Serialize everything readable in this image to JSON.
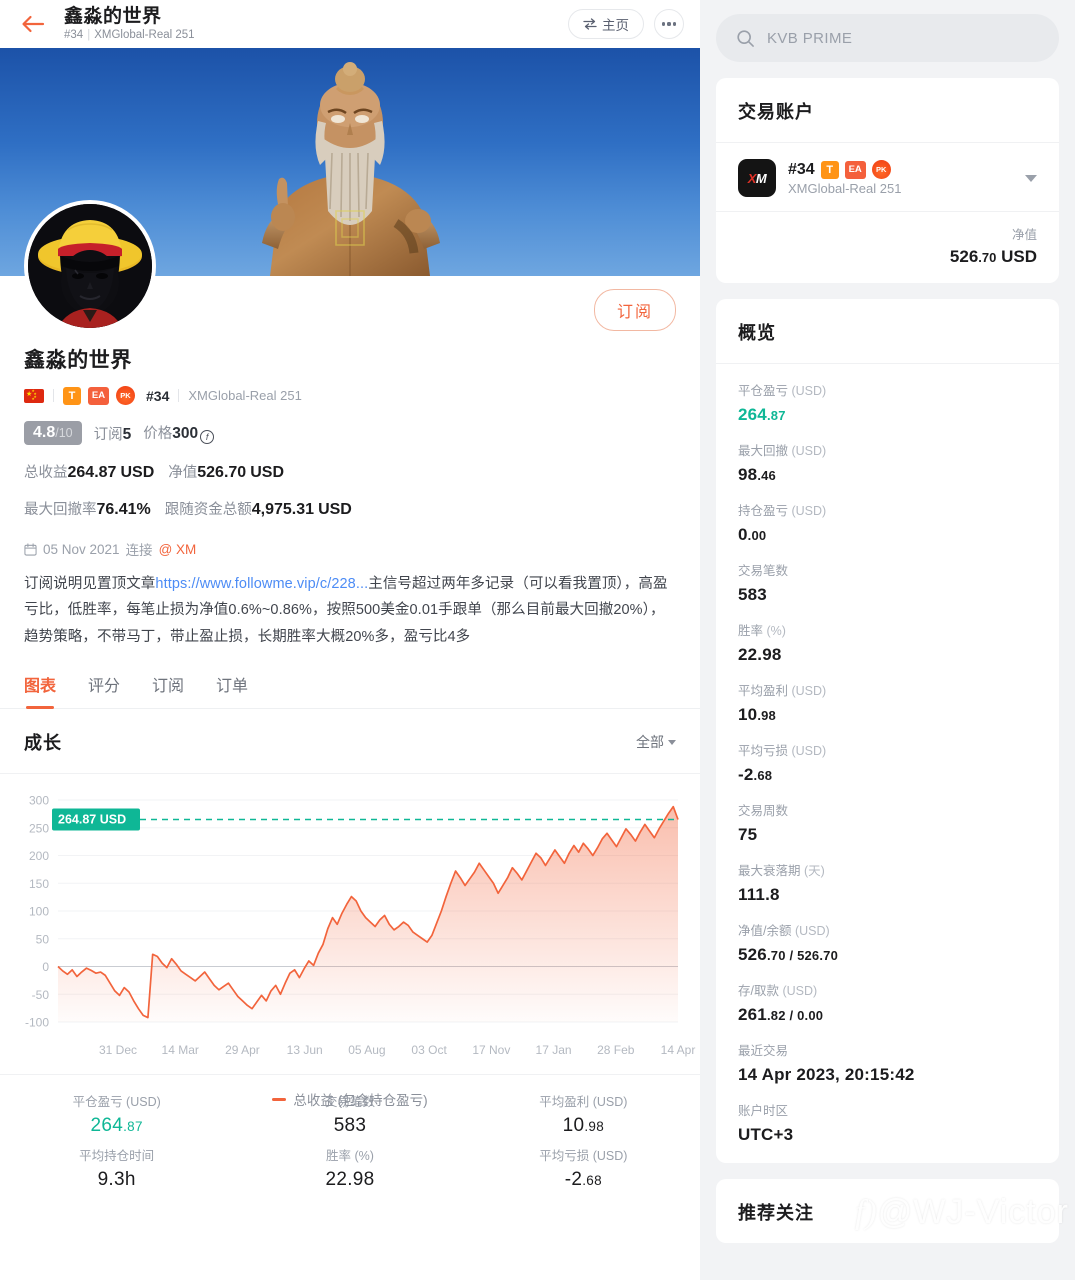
{
  "topbar": {
    "title": "鑫淼的世界",
    "account_id": "#34",
    "separator": "|",
    "server": "XMGlobal-Real 251",
    "home_label": "主页",
    "back_icon": "back-arrow-icon",
    "more_icon": "more-dots-icon"
  },
  "profile": {
    "name": "鑫淼的世界",
    "subscribe_label": "订阅",
    "badges": {
      "flag": "cn-flag-icon",
      "t": "T",
      "ea": "EA",
      "pk": "PK"
    },
    "account_id": "#34",
    "server": "XMGlobal-Real 251",
    "score": "4.8",
    "score_denominator": "/10",
    "subs_label": "订阅",
    "subs_value": "5",
    "price_label": "价格",
    "price_value": "300",
    "total_return_label": "总收益",
    "total_return_value": "264.87",
    "total_return_unit": "USD",
    "equity_label": "净值",
    "equity_value": "526.70",
    "equity_unit": "USD",
    "max_dd_label": "最大回撤率",
    "max_dd_value": "76.41%",
    "follow_funds_label": "跟随资金总额",
    "follow_funds_value": "4,975.31",
    "follow_funds_unit": "USD",
    "connect_date": "05 Nov 2021",
    "connect_label": "连接",
    "broker_handle": "@ XM",
    "description_pre": "订阅说明见置顶文章",
    "description_link": "https://www.followme.vip/c/228...",
    "description_post": "主信号超过两年多记录（可以看我置顶），高盈亏比，低胜率，每笔止损为净值0.6%~0.86%，按照500美金0.01手跟单（那么目前最大回撤20%），趋势策略，不带马丁，带止盈止损，长期胜率大概20%多，盈亏比4多"
  },
  "tabs": [
    {
      "label": "图表",
      "active": true
    },
    {
      "label": "评分",
      "active": false
    },
    {
      "label": "订阅",
      "active": false
    },
    {
      "label": "订单",
      "active": false
    }
  ],
  "chart_section": {
    "title": "成长",
    "filter_label": "全部"
  },
  "chart_data": {
    "type": "area",
    "title": "成长",
    "xlabel": "",
    "ylabel": "",
    "ylim": [
      -100,
      300
    ],
    "yticks": [
      300,
      250,
      200,
      150,
      100,
      50,
      0,
      -50,
      -100
    ],
    "xticks": [
      "31 Dec",
      "14 Mar",
      "29 Apr",
      "13 Jun",
      "05 Aug",
      "03 Oct",
      "17 Nov",
      "17 Jan",
      "28 Feb",
      "14 Apr"
    ],
    "grid": true,
    "legend": "总收益 (包含持仓盈亏)",
    "legend_position": "bottom",
    "line_color": "#f2643c",
    "marker_label": "264.87 USD",
    "marker_value": 264.87,
    "marker_color": "#0fb796",
    "series": [
      {
        "name": "总收益 (包含持仓盈亏)",
        "values": [
          0,
          -8,
          -14,
          -6,
          -18,
          -10,
          -3,
          -7,
          -12,
          -10,
          -16,
          -30,
          -44,
          -52,
          -38,
          -46,
          -62,
          -76,
          -88,
          -92,
          22,
          18,
          6,
          -2,
          14,
          4,
          -8,
          -14,
          -20,
          -26,
          -18,
          -10,
          -22,
          -34,
          -42,
          -36,
          -30,
          -42,
          -54,
          -62,
          -70,
          -76,
          -64,
          -52,
          -62,
          -44,
          -34,
          -50,
          -30,
          -12,
          -6,
          -20,
          -4,
          10,
          2,
          24,
          40,
          68,
          88,
          76,
          96,
          112,
          126,
          118,
          100,
          88,
          80,
          72,
          84,
          92,
          76,
          66,
          72,
          80,
          74,
          62,
          56,
          50,
          44,
          56,
          78,
          100,
          126,
          150,
          172,
          160,
          146,
          158,
          170,
          186,
          174,
          162,
          150,
          132,
          146,
          160,
          178,
          168,
          156,
          172,
          188,
          204,
          196,
          182,
          196,
          210,
          198,
          186,
          204,
          218,
          206,
          222,
          212,
          200,
          214,
          230,
          240,
          228,
          216,
          232,
          248,
          238,
          226,
          242,
          256,
          244,
          232,
          248,
          262,
          276,
          288,
          264.87
        ]
      }
    ]
  },
  "bottom_stats": [
    {
      "label": "平仓盈亏 (USD)",
      "value": "264",
      "dec": ".87",
      "green": true
    },
    {
      "label": "交易笔数",
      "value": "583",
      "dec": "",
      "green": false
    },
    {
      "label": "平均盈利 (USD)",
      "value": "10",
      "dec": ".98",
      "green": false
    },
    {
      "label": "平均持仓时间",
      "value": "9.3h",
      "dec": "",
      "green": false
    },
    {
      "label": "胜率 (%)",
      "value": "22.98",
      "dec": "",
      "green": false
    },
    {
      "label": "平均亏损 (USD)",
      "value": "-2",
      "dec": ".68",
      "green": false
    }
  ],
  "sidebar": {
    "search_placeholder": "KVB PRIME",
    "search_icon": "search-icon",
    "account_card": {
      "title": "交易账户",
      "broker_logo": "XM",
      "account_id": "#34",
      "badges": {
        "t": "T",
        "ea": "EA",
        "pk": "PK"
      },
      "server": "XMGlobal-Real 251",
      "equity_label": "净值",
      "equity_value": "526",
      "equity_dec": ".70",
      "equity_unit": "USD"
    },
    "overview": {
      "title": "概览",
      "items": [
        {
          "label": "平仓盈亏",
          "unit": "(USD)",
          "value": "264",
          "dec": ".87",
          "green": true
        },
        {
          "label": "最大回撤",
          "unit": "(USD)",
          "value": "98",
          "dec": ".46",
          "green": false
        },
        {
          "label": "持仓盈亏",
          "unit": "(USD)",
          "value": "0",
          "dec": ".00",
          "green": false
        },
        {
          "label": "交易笔数",
          "unit": "",
          "value": "583",
          "dec": "",
          "green": false
        },
        {
          "label": "胜率",
          "unit": "(%)",
          "value": "22.98",
          "dec": "",
          "green": false
        },
        {
          "label": "平均盈利",
          "unit": "(USD)",
          "value": "10",
          "dec": ".98",
          "green": false
        },
        {
          "label": "平均亏损",
          "unit": "(USD)",
          "value": "-2",
          "dec": ".68",
          "green": false
        },
        {
          "label": "交易周数",
          "unit": "",
          "value": "75",
          "dec": "",
          "green": false
        },
        {
          "label": "最大衰落期",
          "unit": "(天)",
          "value": "111.8",
          "dec": "",
          "green": false
        },
        {
          "label": "净值/余额",
          "unit": "(USD)",
          "value": "526",
          "dec": ".70 / 526.70",
          "green": false
        },
        {
          "label": "存/取款",
          "unit": "(USD)",
          "value": "261",
          "dec": ".82 / 0.00",
          "green": false
        },
        {
          "label": "最近交易",
          "unit": "",
          "value": "14 Apr 2023, 20:15:42",
          "dec": "",
          "green": false
        },
        {
          "label": "账户时区",
          "unit": "",
          "value": "UTC+3",
          "dec": "",
          "green": false
        }
      ]
    },
    "recommend": {
      "title": "推荐关注"
    },
    "watermark": "@WJ-Victor"
  }
}
